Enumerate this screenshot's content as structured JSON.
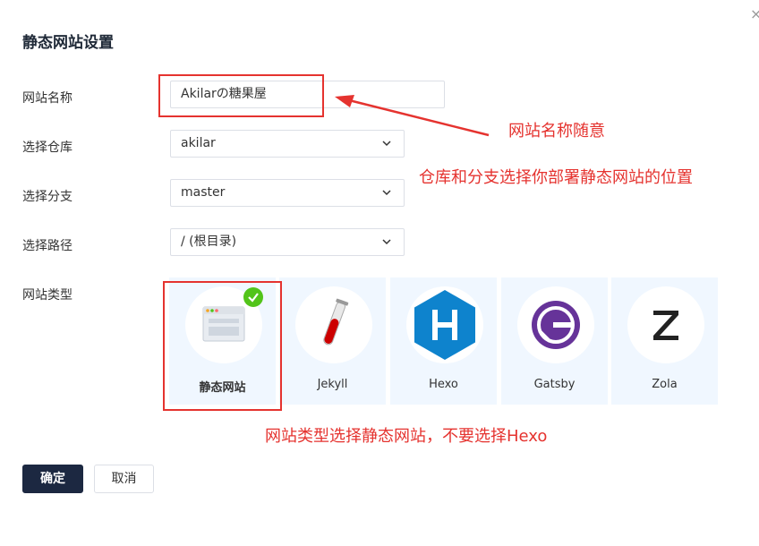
{
  "dialog": {
    "title": "静态网站设置",
    "close": "×"
  },
  "form": {
    "site_name": {
      "label": "网站名称",
      "value": "Akilarの糖果屋"
    },
    "repo": {
      "label": "选择仓库",
      "value": "akilar"
    },
    "branch": {
      "label": "选择分支",
      "value": "master"
    },
    "path": {
      "label": "选择路径",
      "value": "/ (根目录)"
    },
    "site_type": {
      "label": "网站类型"
    }
  },
  "site_types": [
    {
      "name": "静态网站",
      "icon": "browser-window-icon",
      "selected": true
    },
    {
      "name": "Jekyll",
      "icon": "test-tube-icon",
      "selected": false
    },
    {
      "name": "Hexo",
      "icon": "hexo-icon",
      "selected": false
    },
    {
      "name": "Gatsby",
      "icon": "gatsby-icon",
      "selected": false
    },
    {
      "name": "Zola",
      "icon": "zola-icon",
      "selected": false
    }
  ],
  "annotations": {
    "name_note": "网站名称随意",
    "repo_note": "仓库和分支选择你部署静态网站的位置",
    "type_note": "网站类型选择静态网站，不要选择Hexo"
  },
  "buttons": {
    "confirm": "确定",
    "cancel": "取消"
  },
  "colors": {
    "annotation": "#e5332f",
    "primary": "#1c2841",
    "tile_bg": "#f0f7ff",
    "check": "#52c41a",
    "hexo": "#0e83cd",
    "gatsby": "#663399"
  }
}
